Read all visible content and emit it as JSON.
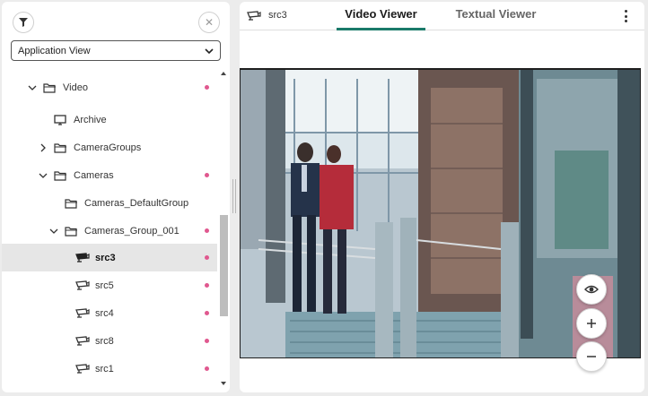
{
  "sidebar": {
    "view_select": {
      "selected": "Application View"
    },
    "tree": [
      {
        "label": "Video",
        "icon": "folder-icon",
        "toggle": "expanded",
        "dot": true
      },
      {
        "label": "Archive",
        "icon": "monitor-icon",
        "toggle": "none",
        "dot": false
      },
      {
        "label": "CameraGroups",
        "icon": "folder-icon",
        "toggle": "collapsed",
        "dot": false
      },
      {
        "label": "Cameras",
        "icon": "folder-icon",
        "toggle": "expanded",
        "dot": true
      },
      {
        "label": "Cameras_DefaultGroup",
        "icon": "folder-icon",
        "toggle": "none",
        "dot": false
      },
      {
        "label": "Cameras_Group_001",
        "icon": "folder-icon",
        "toggle": "expanded",
        "dot": true
      },
      {
        "label": "src3",
        "icon": "camera-icon",
        "toggle": "none",
        "dot": true,
        "selected": true
      },
      {
        "label": "src5",
        "icon": "camera-icon",
        "toggle": "none",
        "dot": true
      },
      {
        "label": "src4",
        "icon": "camera-icon",
        "toggle": "none",
        "dot": true
      },
      {
        "label": "src8",
        "icon": "camera-icon",
        "toggle": "none",
        "dot": true
      },
      {
        "label": "src1",
        "icon": "camera-icon",
        "toggle": "none",
        "dot": true
      }
    ]
  },
  "viewer": {
    "source_title": "src3",
    "tabs": [
      {
        "label": "Video Viewer",
        "active": true
      },
      {
        "label": "Textual Viewer",
        "active": false
      }
    ]
  },
  "colors": {
    "accent": "#1a7a6a",
    "status_dot": "#e0588f",
    "selected_row": "#e6e6e6"
  }
}
